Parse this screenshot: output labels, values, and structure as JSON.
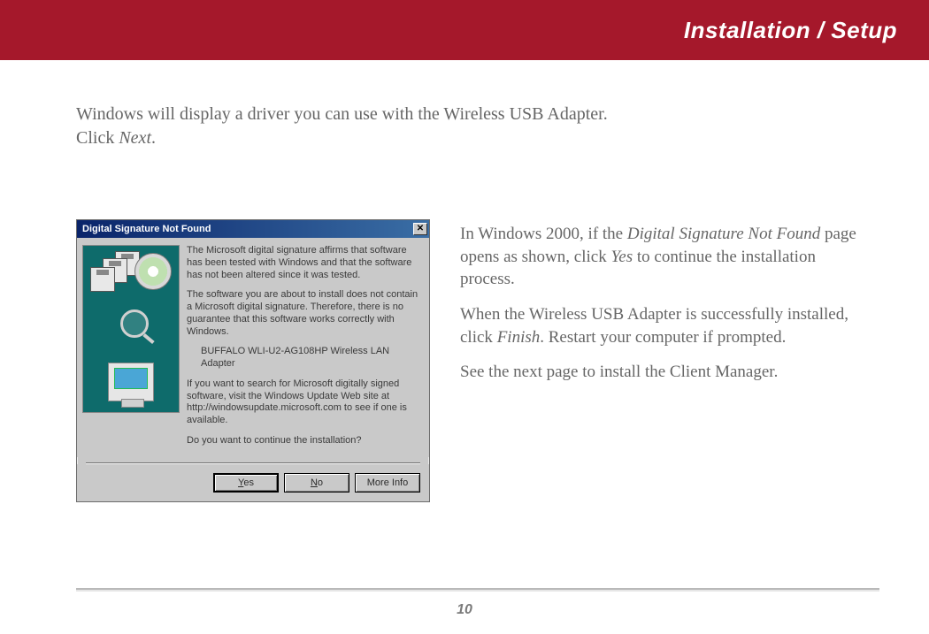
{
  "header": {
    "title": "Installation / Setup"
  },
  "intro": {
    "line1": "Windows will display a driver you can use with the Wireless USB Adapter.",
    "line2_pre": "Click ",
    "line2_em": "Next",
    "line2_post": "."
  },
  "dialog": {
    "title": "Digital Signature Not Found",
    "p1": "The Microsoft digital signature affirms that software has been tested with Windows and that the software has not been altered since it was tested.",
    "p2": "The software you are about to install does not contain a Microsoft digital signature. Therefore, there is no guarantee that this software works correctly with Windows.",
    "device": "BUFFALO WLI-U2-AG108HP Wireless LAN Adapter",
    "p3": "If you want to search for Microsoft digitally signed software, visit the Windows Update Web site at http://windowsupdate.microsoft.com to see if one is available.",
    "p4": "Do you want to continue the installation?",
    "buttons": {
      "yes_u": "Y",
      "yes_rest": "es",
      "no_u": "N",
      "no_rest": "o",
      "more": "More Info"
    }
  },
  "right": {
    "p1_a": "In Windows 2000, if the ",
    "p1_em1": "Digital Signature Not Found",
    "p1_b": " page opens as shown, click ",
    "p1_em2": "Yes",
    "p1_c": " to continue the installation process.",
    "p2_a": "When the Wireless USB Adapter is successfully installed, click ",
    "p2_em": "Finish",
    "p2_b": ".  Restart your computer if prompted.",
    "p3": "See the next page to install the Client Manager."
  },
  "page_number": "10"
}
